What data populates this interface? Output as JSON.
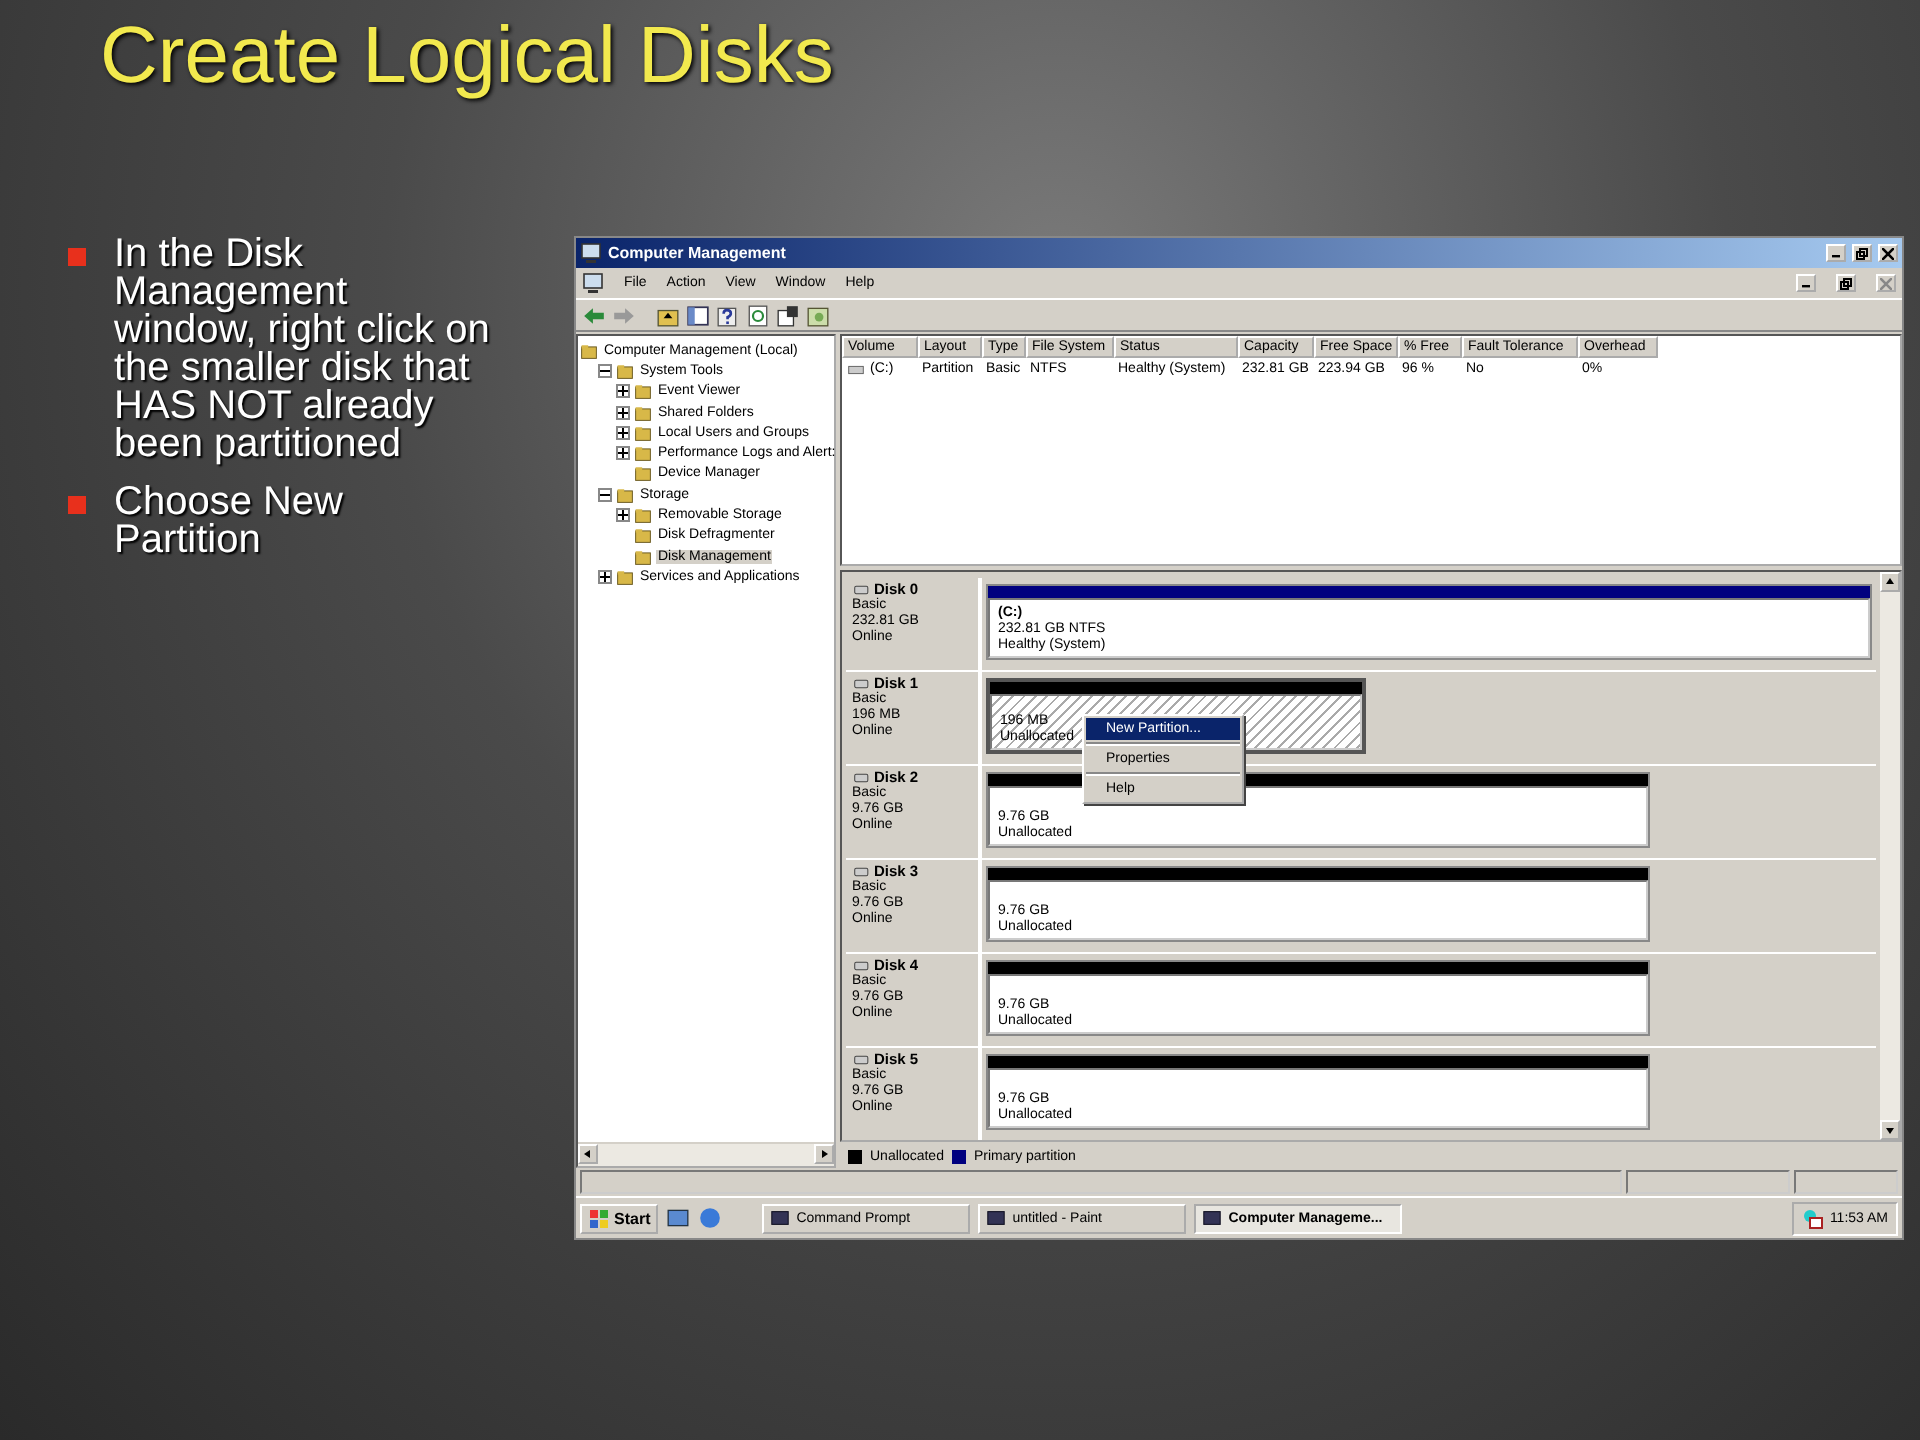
{
  "slide": {
    "title": "Create Logical Disks",
    "bullets": [
      "In the Disk Management window, right click on the smaller disk that HAS NOT already been partitioned",
      "Choose New Partition"
    ]
  },
  "window": {
    "title": "Computer Management",
    "menu": [
      "File",
      "Action",
      "View",
      "Window",
      "Help"
    ],
    "tree": [
      {
        "label": "Computer Management (Local)",
        "selected": false,
        "children": [
          {
            "label": "System Tools",
            "selected": false,
            "expanded": true,
            "children": [
              {
                "label": "Event Viewer",
                "selected": false,
                "expanded": false
              },
              {
                "label": "Shared Folders",
                "selected": false,
                "expanded": false
              },
              {
                "label": "Local Users and Groups",
                "selected": false,
                "expanded": false
              },
              {
                "label": "Performance Logs and Alert:",
                "selected": false,
                "expanded": false
              },
              {
                "label": "Device Manager",
                "selected": false
              }
            ]
          },
          {
            "label": "Storage",
            "selected": false,
            "expanded": true,
            "children": [
              {
                "label": "Removable Storage",
                "selected": false,
                "expanded": false
              },
              {
                "label": "Disk Defragmenter",
                "selected": false
              },
              {
                "label": "Disk Management",
                "selected": true
              }
            ]
          },
          {
            "label": "Services and Applications",
            "selected": false,
            "expanded": false
          }
        ]
      }
    ],
    "volumes": {
      "columns": [
        "Volume",
        "Layout",
        "Type",
        "File System",
        "Status",
        "Capacity",
        "Free Space",
        "% Free",
        "Fault Tolerance",
        "Overhead"
      ],
      "rows": [
        [
          "(C:)",
          "Partition",
          "Basic",
          "NTFS",
          "Healthy (System)",
          "232.81 GB",
          "223.94 GB",
          "96 %",
          "No",
          "0%"
        ]
      ]
    },
    "disks": [
      {
        "name": "Disk 0",
        "type": "Basic",
        "size": "232.81 GB",
        "status": "Online",
        "partition": {
          "kind": "primary",
          "selected": false,
          "label": "(C:)",
          "size": "232.81 GB NTFS",
          "status": "Healthy (System)"
        }
      },
      {
        "name": "Disk 1",
        "type": "Basic",
        "size": "196 MB",
        "status": "Online",
        "partition": {
          "kind": "unallocated",
          "selected": true,
          "size": "196 MB",
          "status": "Unallocated"
        }
      },
      {
        "name": "Disk 2",
        "type": "Basic",
        "size": "9.76 GB",
        "status": "Online",
        "partition": {
          "kind": "unallocated",
          "selected": false,
          "size": "9.76 GB",
          "status": "Unallocated"
        }
      },
      {
        "name": "Disk 3",
        "type": "Basic",
        "size": "9.76 GB",
        "status": "Online",
        "partition": {
          "kind": "unallocated",
          "selected": false,
          "size": "9.76 GB",
          "status": "Unallocated"
        }
      },
      {
        "name": "Disk 4",
        "type": "Basic",
        "size": "9.76 GB",
        "status": "Online",
        "partition": {
          "kind": "unallocated",
          "selected": false,
          "size": "9.76 GB",
          "status": "Unallocated"
        }
      },
      {
        "name": "Disk 5",
        "type": "Basic",
        "size": "9.76 GB",
        "status": "Online",
        "partition": {
          "kind": "unallocated",
          "selected": false,
          "size": "9.76 GB",
          "status": "Unallocated"
        }
      }
    ],
    "context_menu": [
      {
        "label": "New Partition...",
        "selected": true
      },
      {
        "label": "Properties",
        "selected": false
      },
      {
        "label": "Help",
        "selected": false
      }
    ],
    "legend": [
      {
        "label": "Unallocated",
        "color": "#000000"
      },
      {
        "label": "Primary partition",
        "color": "#00007f"
      }
    ]
  },
  "taskbar": {
    "start": "Start",
    "tasks": [
      {
        "label": "Command Prompt",
        "selected": false
      },
      {
        "label": "untitled - Paint",
        "selected": false
      },
      {
        "label": "Computer Manageme...",
        "selected": true
      }
    ],
    "clock": "11:53 AM"
  }
}
